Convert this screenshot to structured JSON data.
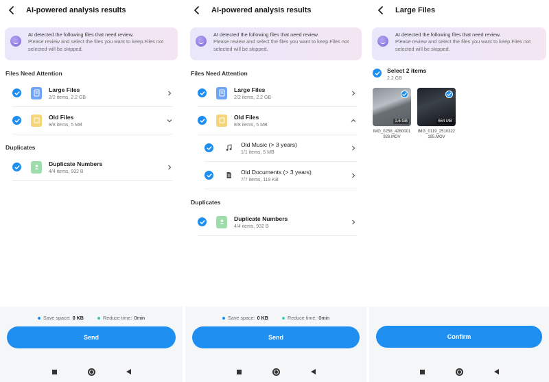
{
  "colors": {
    "accent": "#1f8ef1",
    "teal": "#41c9b4",
    "bottom_bg": "#f5f6f8"
  },
  "screen1": {
    "title": "AI-powered analysis results",
    "banner": {
      "line1": "AI detected the following files that need review.",
      "line2": "Please review and select the files you want to keep.Files not selected will be skipped."
    },
    "section_attention": "Files Need Attention",
    "large_files": {
      "title": "Large Files",
      "sub": "2/2 items, 2.2 GB"
    },
    "old_files": {
      "title": "Old Files",
      "sub": "8/8 items, 5 MB"
    },
    "section_duplicates": "Duplicates",
    "duplicate_numbers": {
      "title": "Duplicate Numbers",
      "sub": "4/4 items, 932 B"
    },
    "save_label": "Save space:",
    "save_value": "0 KB",
    "reduce_label": "Reduce time:",
    "reduce_value": "0min",
    "button": "Send"
  },
  "screen2": {
    "title": "AI-powered analysis results",
    "banner": {
      "line1": "AI detected the following files that need review.",
      "line2": "Please review and select the files you want to keep.Files not selected will be skipped."
    },
    "section_attention": "Files Need Attention",
    "large_files": {
      "title": "Large Files",
      "sub": "2/2 items, 2.2 GB"
    },
    "old_files": {
      "title": "Old Files",
      "sub": "8/8 items, 5 MB"
    },
    "old_music": {
      "title": "Old Music (> 3 years)",
      "sub": "1/1 items, 5 MB"
    },
    "old_documents": {
      "title": "Old Documents (> 3 years)",
      "sub": "7/7 items, 119 KB"
    },
    "section_duplicates": "Duplicates",
    "duplicate_numbers": {
      "title": "Duplicate Numbers",
      "sub": "4/4 items, 932 B"
    },
    "save_label": "Save space:",
    "save_value": "0 KB",
    "reduce_label": "Reduce time:",
    "reduce_value": "0min",
    "button": "Send"
  },
  "screen3": {
    "title": "Large Files",
    "banner": {
      "line1": "AI detected the following files that need review.",
      "line2": "Please review and select the files you want to keep.Files not selected will be skipped."
    },
    "select_title": "Select 2 items",
    "select_sub": "2.2 GB",
    "thumbnails": [
      {
        "size": "1.6 GB",
        "name": "IMG_0258_4280001926.MOV"
      },
      {
        "size": "664 MB",
        "name": "IMG_0119_2510322195.MOV"
      }
    ],
    "button": "Confirm"
  }
}
